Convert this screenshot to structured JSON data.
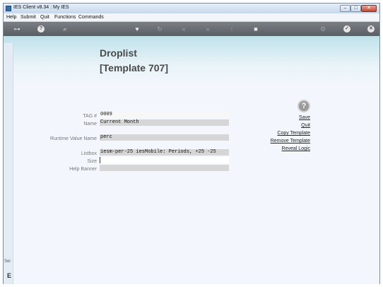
{
  "window": {
    "title": "IES Client v8.34 : My IES",
    "controls": {
      "minimize": "–",
      "maximize": "□",
      "close": "✕"
    }
  },
  "menu": {
    "items": [
      "Help",
      "Submit",
      "Quit",
      "Functions",
      "Commands"
    ]
  },
  "toolbar": {
    "icons": [
      "key-icon",
      "info-icon",
      "search-icon",
      "heart-icon",
      "refresh-icon",
      "rewind-icon",
      "fast-forward-icon",
      "upload-icon",
      "stop-icon",
      "settings-icon",
      "ok-icon",
      "cancel-icon"
    ]
  },
  "page": {
    "title": "Droplist",
    "subtitle": "[Template 707]"
  },
  "form": {
    "tag_label": "TAG #",
    "tag_value": "0009",
    "name_label": "Name",
    "name_value": "Current Month",
    "runtime_label": "Runtime Value Name",
    "runtime_value": "perc",
    "listbox_label": "Listbox",
    "listbox_value": "iesm-per-25 iesMobile: Periods, +25 -25",
    "size_label": "Size",
    "size_value": "",
    "help_banner_label": "Help Banner",
    "help_banner_value": ""
  },
  "actions": {
    "help": "?",
    "save": "Save",
    "quit": "Quit",
    "copy_template": "Copy Template",
    "remove_template": "Remove Template",
    "reveal_logic": "Reveal Logic"
  },
  "left_rail": {
    "text": "Sei",
    "mark": "E"
  },
  "colors": {
    "toolbar": "#6a6f74",
    "canvas_top": "#bfe1ea",
    "canvas": "#f3f7fd",
    "field_gray": "#d6d6d6"
  }
}
